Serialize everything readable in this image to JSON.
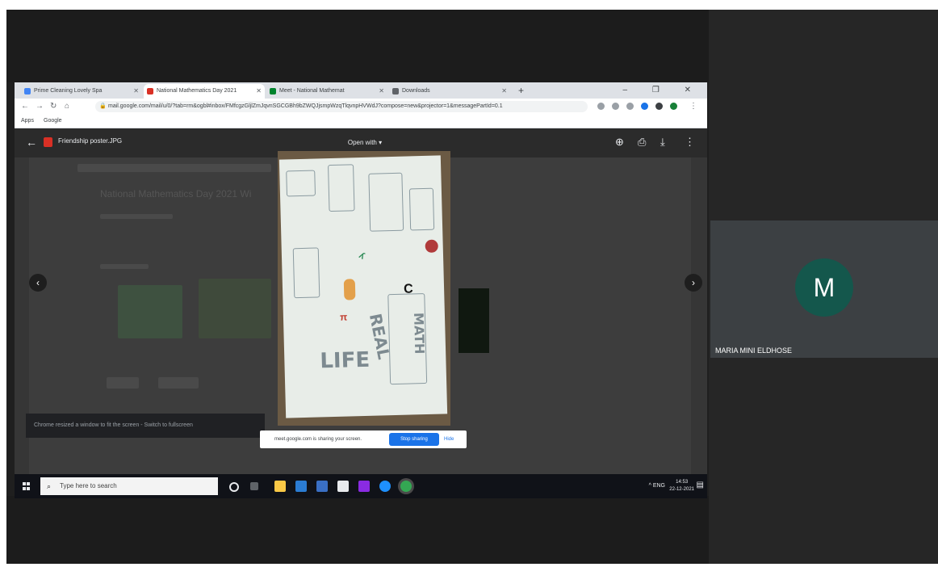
{
  "browser": {
    "tabs": [
      {
        "label": "Prime Cleaning Lovely Spa",
        "active": false,
        "favicon_color": "#4285f4"
      },
      {
        "label": "National Mathematics Day 2021",
        "active": true,
        "favicon_color": "#d93025"
      },
      {
        "label": "Meet - National Mathemat",
        "active": false,
        "favicon_color": "#00832d"
      },
      {
        "label": "Downloads",
        "active": false,
        "favicon_color": "#5f6368"
      }
    ],
    "new_tab_label": "+",
    "window_controls": "– ❐ ✕",
    "address": "mail.google.com/mail/u/0/?tab=rm&ogbl#inbox/FMfcgzGljlZmJqvnSGCGBh9bZWQJjsmpWzqTlqvnpHVWdJ?compose=new&projector=1&messagePartId=0.1",
    "bookmarks": [
      "Apps",
      "Google"
    ]
  },
  "viewer": {
    "file_name": "Friendship poster.JPG",
    "open_with_label": "Open with ▾",
    "dim_title": "National Mathematics Day 2021 Wi"
  },
  "notification": {
    "text": "Chrome resized a window to fit the screen - Switch to fullscreen"
  },
  "sharebar": {
    "message": "meet.google.com is sharing your screen.",
    "stop_label": "Stop sharing",
    "hide_label": "Hide"
  },
  "taskbar": {
    "search_placeholder": "Type here to search",
    "tray_text": "^  ENG",
    "time": "14:53",
    "date": "22-12-2021"
  },
  "participant": {
    "initial": "M",
    "name": "MARIA MINI ELDHOSE",
    "avatar_color": "#14574c"
  },
  "poster": {
    "texts": [
      "REAL",
      "LIFE",
      "MATH"
    ]
  }
}
